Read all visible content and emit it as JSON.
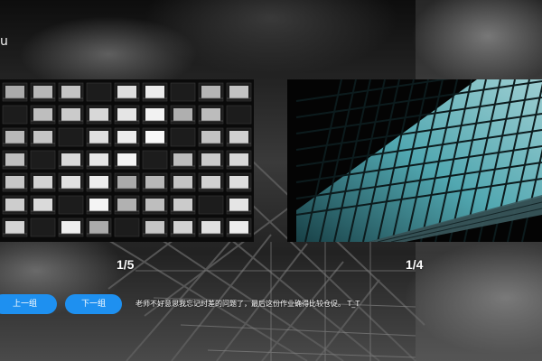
{
  "header": {
    "title_fragment": "u"
  },
  "gallery": {
    "left_counter": "1/5",
    "right_counter": "1/4",
    "left_image": "night-apartment-windows-photo",
    "right_image": "glass-facade-building-photo"
  },
  "controls": {
    "prev_label": "上一组",
    "next_label": "下一组"
  },
  "note": {
    "text": "老师不好意思我忘记时差的问题了，最后这份作业确得比较仓促。 T_T"
  },
  "colors": {
    "button_bg": "#1e90f0",
    "button_text": "#ffffff",
    "accent_cyan": "#7fe3ee"
  }
}
